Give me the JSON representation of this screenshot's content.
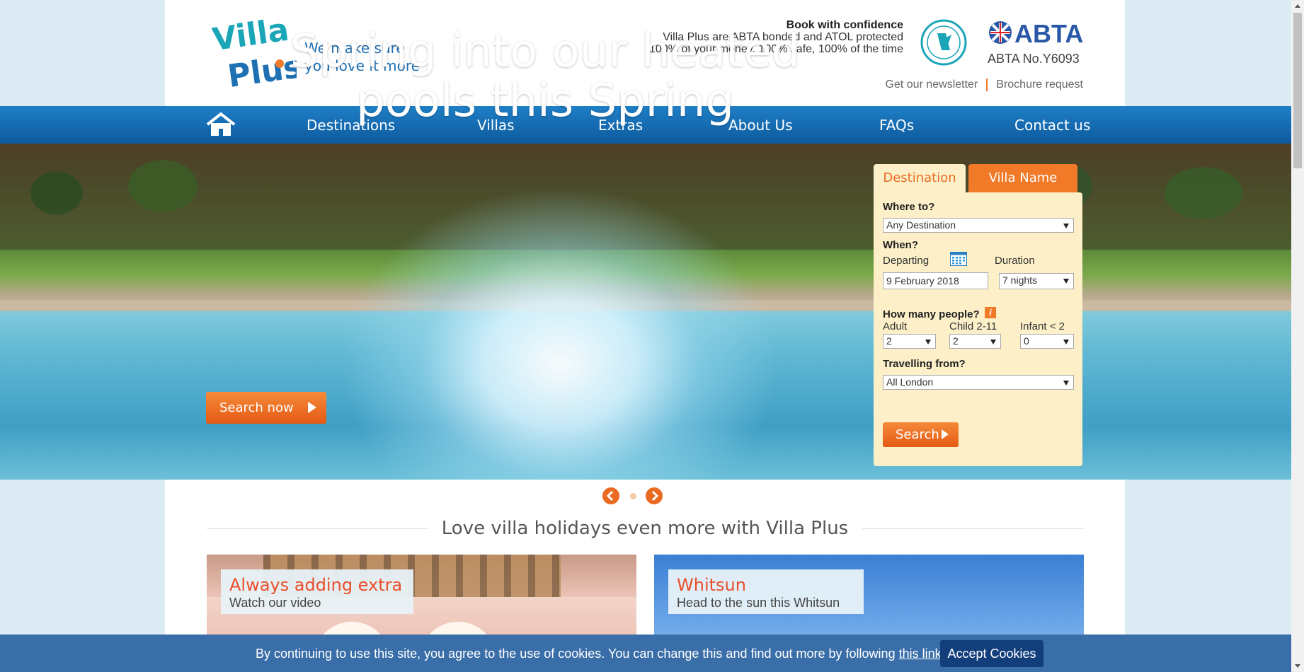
{
  "header": {
    "tagline_line1": "We make sure",
    "tagline_line2": "you love it more",
    "confidence_head": "Book with confidence",
    "confidence_line1": "Villa Plus are ABTA bonded and ATOL protected",
    "confidence_line2": "100% of your money, 100% safe, 100% of the time",
    "abta_logo": "ABTA",
    "abta_number": "ABTA No.Y6093",
    "newsletter_link": "Get our newsletter",
    "brochure_link": "Brochure request"
  },
  "nav": {
    "items": [
      "Destinations",
      "Villas",
      "Extras",
      "About Us",
      "FAQs",
      "Contact us"
    ]
  },
  "hero": {
    "title_line1": "Spring into our heated",
    "title_line2": "pools this Spring",
    "search_now": "Search now"
  },
  "search": {
    "tabs": [
      "Destination",
      "Villa Name"
    ],
    "where_label": "Where to?",
    "destination_value": "Any Destination",
    "when_label": "When?",
    "departing_label": "Departing",
    "duration_label": "Duration",
    "departing_value": "9 February 2018",
    "duration_value": "7 nights",
    "people_label": "How many people?",
    "info_glyph": "i",
    "adult_label": "Adult",
    "child_label": "Child 2-11",
    "infant_label": "Infant < 2",
    "adult_value": "2",
    "child_value": "2",
    "infant_value": "0",
    "from_label": "Travelling from?",
    "from_value": "All London",
    "search_button": "Search"
  },
  "section": {
    "title": "Love villa holidays even more with Villa Plus"
  },
  "cards": [
    {
      "title": "Always adding extra",
      "subtitle": "Watch our video"
    },
    {
      "title": "Whitsun",
      "subtitle": "Head to the sun this Whitsun"
    }
  ],
  "cookie": {
    "message_before": "By continuing to use this site, you agree to the use of cookies. You can change this and find out more by following ",
    "link": "this link",
    "message_after": ".",
    "accept": "Accept Cookies"
  },
  "colors": {
    "brand_blue": "#1f6fb3",
    "accent_orange": "#f07a28",
    "panel_cream": "#fdf0c9",
    "cookie_bar": "#3a6ea8"
  },
  "icons": {
    "home": "home-icon",
    "calendar": "calendar-icon",
    "prev": "chevron-left-icon",
    "next": "chevron-right-icon",
    "info": "info-icon"
  }
}
